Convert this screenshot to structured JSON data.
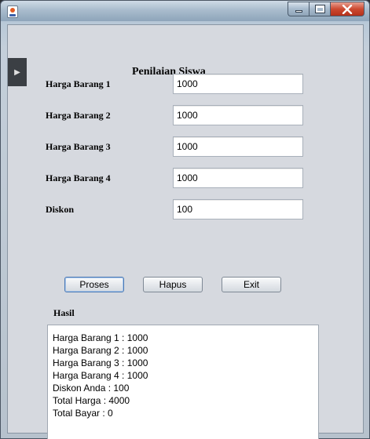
{
  "window": {
    "controls": {
      "minimize": "minimize",
      "maximize": "maximize",
      "close": "close"
    }
  },
  "form": {
    "title": "Penilaian Siswa",
    "fields": [
      {
        "label": "Harga Barang 1",
        "value": "1000"
      },
      {
        "label": "Harga Barang 2",
        "value": "1000"
      },
      {
        "label": "Harga Barang 3",
        "value": "1000"
      },
      {
        "label": "Harga Barang 4",
        "value": "1000"
      },
      {
        "label": "Diskon",
        "value": "100"
      }
    ],
    "buttons": {
      "proses": "Proses",
      "hapus": "Hapus",
      "exit": "Exit"
    },
    "result_label": "Hasil",
    "result_lines": [
      "Harga Barang 1 : 1000",
      "Harga Barang 2 : 1000",
      "Harga Barang 3 : 1000",
      "Harga Barang 4 : 1000",
      "Diskon Anda : 100",
      "Total Harga : 4000",
      "Total Bayar : 0"
    ]
  },
  "icons": {
    "app": "java-icon",
    "side_tab": "expand-arrow-icon"
  }
}
